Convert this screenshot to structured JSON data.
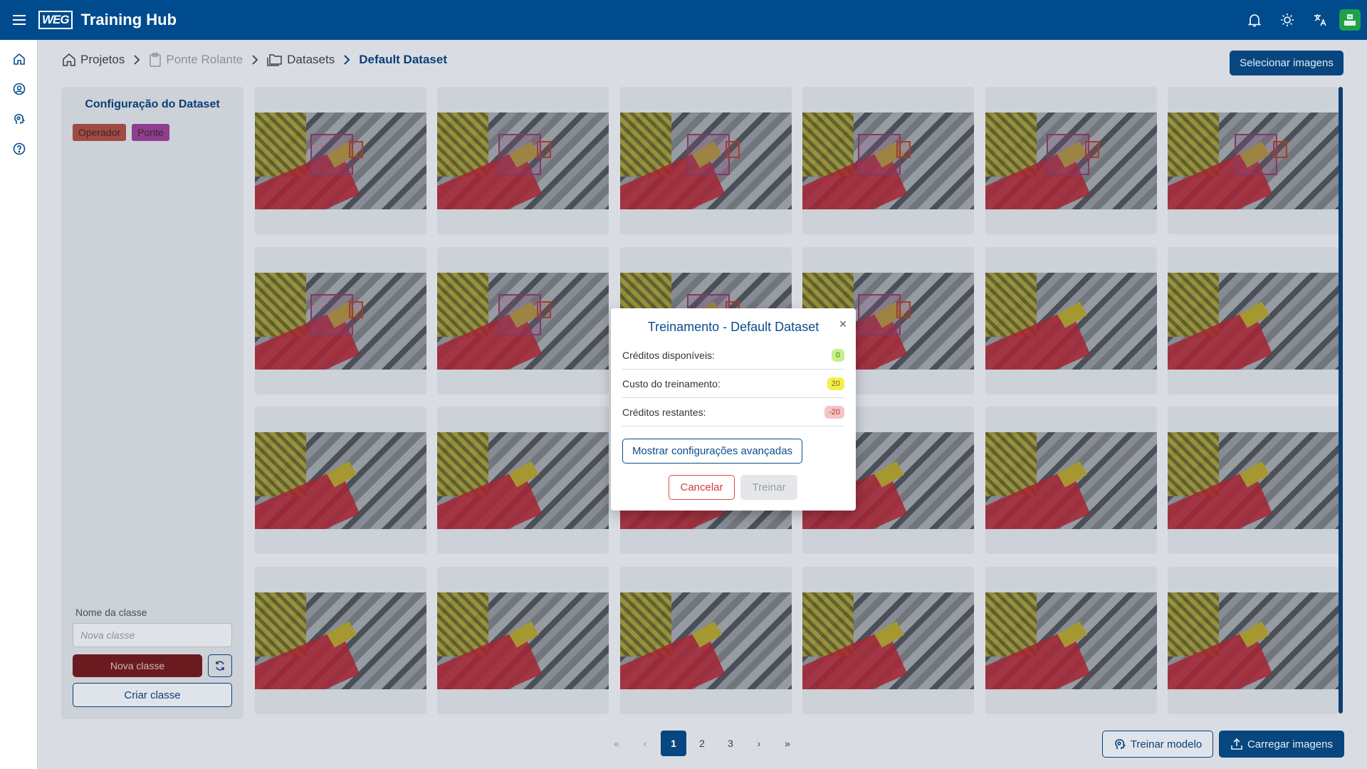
{
  "app": {
    "logo_text": "WEG",
    "title": "Training Hub"
  },
  "topbar": {
    "icons": [
      "menu-icon",
      "bell-icon",
      "sun-icon",
      "translate-icon",
      "avatar-icon"
    ]
  },
  "sidenav": {
    "icons": [
      "home-icon",
      "user-circle-icon",
      "brain-icon",
      "help-icon"
    ]
  },
  "breadcrumb": {
    "items": [
      {
        "label": "Projetos",
        "icon": "home-icon",
        "state": "normal"
      },
      {
        "label": "Ponte Rolante",
        "icon": "clipboard-icon",
        "state": "disabled"
      },
      {
        "label": "Datasets",
        "icon": "folder-icon",
        "state": "normal"
      },
      {
        "label": "Default Dataset",
        "icon": "",
        "state": "current"
      }
    ]
  },
  "header": {
    "select_images_label": "Selecionar imagens"
  },
  "config_panel": {
    "title": "Configuração do Dataset",
    "classes": [
      {
        "label": "Operador",
        "color": "#a04a44"
      },
      {
        "label": "Ponte",
        "color": "#8e3d8f"
      }
    ],
    "class_name_label": "Nome da classe",
    "class_name_placeholder": "Nova classe",
    "new_class_label": "Nova classe",
    "create_class_label": "Criar classe"
  },
  "grid": {
    "columns": 6,
    "rows": 4,
    "annotated_cards": [
      0,
      1,
      2,
      3,
      4,
      5,
      6,
      7,
      8,
      9
    ]
  },
  "pagination": {
    "pages": [
      "1",
      "2",
      "3"
    ],
    "current": "1",
    "first": "«",
    "prev": "‹",
    "next": "›",
    "last": "»"
  },
  "footer": {
    "train_model_label": "Treinar modelo",
    "upload_images_label": "Carregar imagens"
  },
  "modal": {
    "title": "Treinamento - Default Dataset",
    "rows": [
      {
        "label": "Créditos disponíveis:",
        "value": "0",
        "color": "#c9ef8d",
        "text_color": "#4d7a15"
      },
      {
        "label": "Custo do treinamento:",
        "value": "20",
        "color": "#f5ef4c",
        "text_color": "#7a6d0b"
      },
      {
        "label": "Créditos restantes:",
        "value": "-20",
        "color": "#f4c4c4",
        "text_color": "#b33a3a"
      }
    ],
    "advanced_label": "Mostrar configurações avançadas",
    "cancel_label": "Cancelar",
    "train_label": "Treinar"
  }
}
